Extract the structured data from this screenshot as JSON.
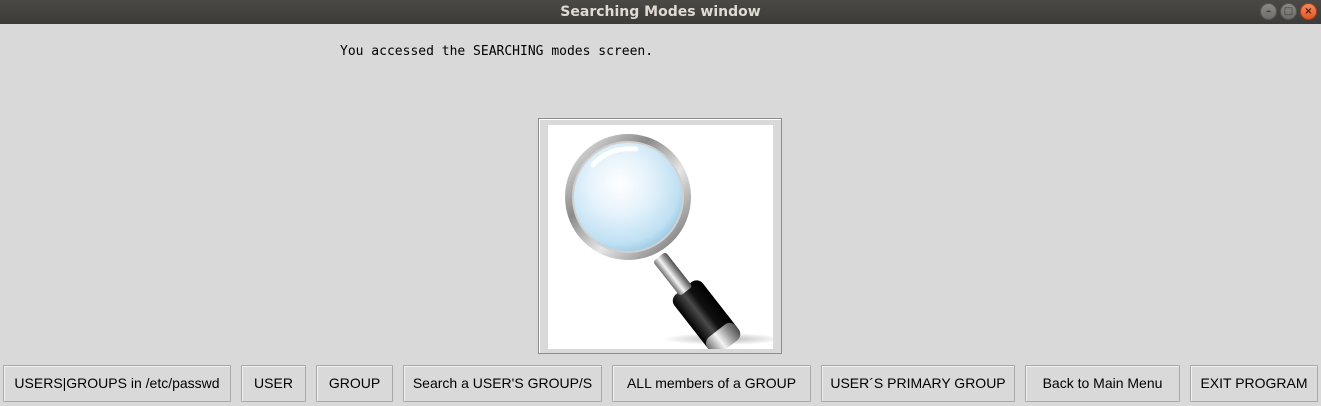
{
  "window": {
    "title": "Searching Modes window"
  },
  "main": {
    "message": "You accessed the SEARCHING modes screen.",
    "image_icon": "magnifying-glass-icon"
  },
  "buttons": [
    {
      "label": "USERS|GROUPS in /etc/passwd"
    },
    {
      "label": "USER"
    },
    {
      "label": "GROUP"
    },
    {
      "label": "Search a USER'S GROUP/S"
    },
    {
      "label": "ALL members of a GROUP"
    },
    {
      "label": "USER´S PRIMARY GROUP"
    },
    {
      "label": "Back to Main Menu"
    },
    {
      "label": "EXIT PROGRAM"
    }
  ],
  "colors": {
    "background": "#d9d9d9",
    "titlebar": "#3c3b37",
    "close_button": "#e25a27"
  }
}
